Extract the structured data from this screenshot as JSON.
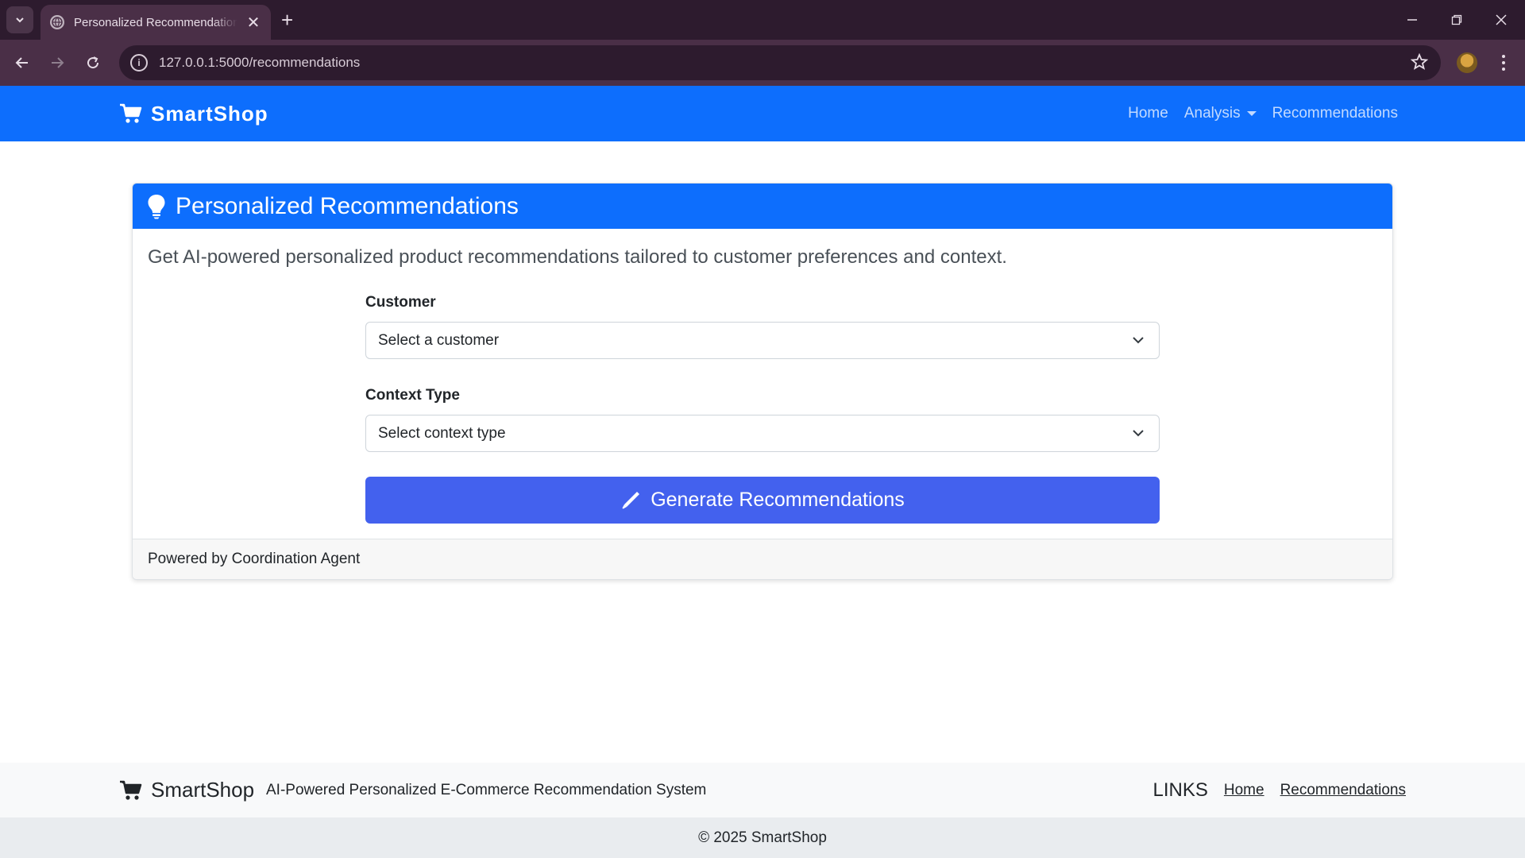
{
  "browser": {
    "tab_title": "Personalized Recommendations",
    "url": "127.0.0.1:5000/recommendations"
  },
  "navbar": {
    "brand": "SmartShop",
    "links": [
      "Home",
      "Analysis",
      "Recommendations"
    ]
  },
  "card": {
    "title": "Personalized Recommendations",
    "lead": "Get AI-powered personalized product recommendations tailored to customer preferences and context.",
    "customer_label": "Customer",
    "customer_value": "Select a customer",
    "context_label": "Context Type",
    "context_value": "Select context type",
    "button": "Generate Recommendations",
    "footer": "Powered by Coordination Agent"
  },
  "footer": {
    "brand": "SmartShop",
    "tagline": "AI-Powered Personalized E-Commerce Recommendation System",
    "links_heading": "LINKS",
    "links": [
      "Home",
      "Recommendations"
    ],
    "copyright": "© 2025 SmartShop"
  },
  "colors": {
    "primary": "#0d6efd",
    "button": "#4361ee",
    "chrome_dark": "#2d1b2e",
    "chrome_mid": "#4a2f47"
  }
}
